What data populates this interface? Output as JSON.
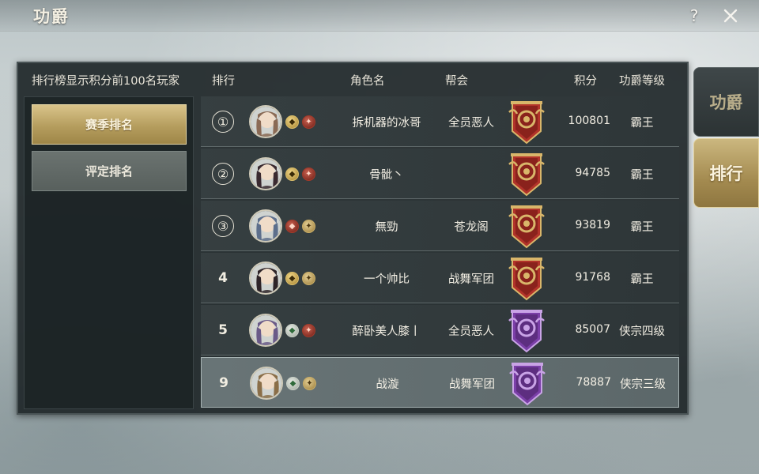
{
  "window": {
    "title": "功爵",
    "help_label": "?",
    "close_icon": "close-icon"
  },
  "panel": {
    "info_text": "排行榜显示积分前100名玩家",
    "headers": {
      "rank": "排行",
      "name": "角色名",
      "guild": "帮会",
      "score": "积分",
      "level": "功爵等级"
    },
    "tabs": {
      "season": "赛季排名",
      "rating": "评定排名"
    },
    "rows": [
      {
        "rank": "①",
        "rank_style": "circle",
        "name": "拆机器的冰哥",
        "guild": "全员恶人",
        "score": "100801",
        "level": "霸王",
        "emblem": "red-gold-banner-emblem",
        "badge1": "b-gold",
        "badge1_icon": "faction-icon",
        "badge2": "b-red",
        "badge2_icon": "sect-icon",
        "avatar_hue": "#8a6a55"
      },
      {
        "rank": "②",
        "rank_style": "circle",
        "name": "骨骴丶",
        "guild": "",
        "score": "94785",
        "level": "霸王",
        "emblem": "red-gold-banner-emblem",
        "badge1": "b-gold",
        "badge1_icon": "faction-icon",
        "badge2": "b-red",
        "badge2_icon": "sect-icon",
        "avatar_hue": "#3a2a30"
      },
      {
        "rank": "③",
        "rank_style": "circle",
        "name": "無勁",
        "guild": "苍龙阁",
        "score": "93819",
        "level": "霸王",
        "emblem": "red-gold-banner-emblem",
        "badge1": "b-red",
        "badge1_icon": "faction-icon",
        "badge2": "b-tan",
        "badge2_icon": "sect-icon",
        "avatar_hue": "#5d6f8c"
      },
      {
        "rank": "4",
        "rank_style": "plain",
        "name": "一个帅比",
        "guild": "战舞军团",
        "score": "91768",
        "level": "霸王",
        "emblem": "red-gold-banner-emblem",
        "badge1": "b-gold",
        "badge1_icon": "faction-icon",
        "badge2": "b-tan",
        "badge2_icon": "sect-icon",
        "avatar_hue": "#2e2428"
      },
      {
        "rank": "5",
        "rank_style": "plain",
        "name": "醉卧美人膝丨",
        "guild": "全员恶人",
        "score": "85007",
        "level": "侠宗四级",
        "emblem": "purple-banner-emblem",
        "badge1": "b-green",
        "badge1_icon": "faction-icon",
        "badge2": "b-red",
        "badge2_icon": "sect-icon",
        "avatar_hue": "#6a5a88"
      },
      {
        "rank": "9",
        "rank_style": "plain",
        "name": "战漩",
        "guild": "战舞军团",
        "score": "78887",
        "level": "侠宗三级",
        "emblem": "purple-banner-emblem",
        "badge1": "b-green",
        "badge1_icon": "faction-icon",
        "badge2": "b-tan",
        "badge2_icon": "sect-icon",
        "avatar_hue": "#8a6e48",
        "self": true
      }
    ]
  },
  "side_tabs": {
    "gongjue": "功爵",
    "paihang": "排行"
  },
  "colors": {
    "gold_accent": "#c8b072",
    "panel_bg": "#20282a",
    "red_emblem": "#b2332a",
    "purple_emblem": "#7b3fa8"
  }
}
